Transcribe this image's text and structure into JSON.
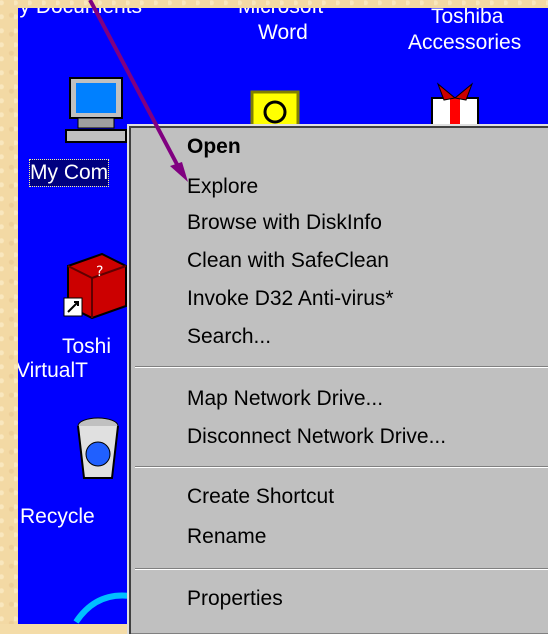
{
  "desktop": {
    "top_labels": [
      "My Documents",
      "Microsoft",
      "Word",
      "Toshiba",
      "Accessories"
    ],
    "icons": [
      {
        "name": "my-computer",
        "label": "My Com"
      },
      {
        "name": "toshiba-virtual",
        "label1": "Toshi",
        "label2": "VirtualT"
      },
      {
        "name": "recycle-bin",
        "label": "Recycle"
      }
    ]
  },
  "menu": {
    "items": [
      {
        "id": "open",
        "label": "Open",
        "bold": true
      },
      {
        "id": "explore",
        "label": "Explore"
      },
      {
        "id": "browse-diskinfo",
        "label": "Browse with DiskInfo"
      },
      {
        "id": "clean-safeclean",
        "label": "Clean with SafeClean"
      },
      {
        "id": "invoke-d32",
        "label": "Invoke D32 Anti-virus*"
      },
      {
        "id": "search",
        "label": "Search..."
      },
      {
        "id": "map-network-drive",
        "label": "Map Network Drive..."
      },
      {
        "id": "disconnect-network-drive",
        "label": "Disconnect Network Drive..."
      },
      {
        "id": "create-shortcut",
        "label": "Create Shortcut"
      },
      {
        "id": "rename",
        "label": "Rename"
      },
      {
        "id": "properties",
        "label": "Properties"
      }
    ]
  },
  "colors": {
    "desktop": "#0000ff",
    "menu": "#c0c0c0",
    "arrow": "#800080",
    "parchment": "#f3d9a4"
  }
}
